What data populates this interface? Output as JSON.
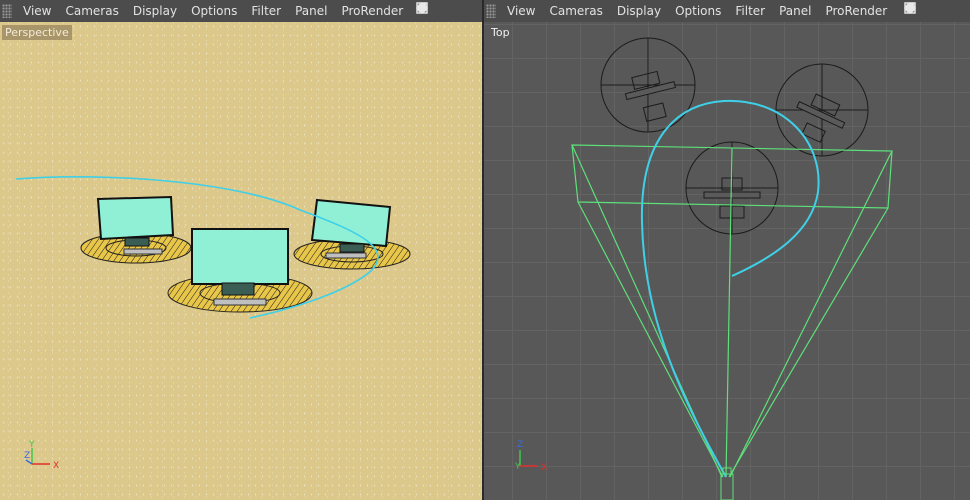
{
  "menu": {
    "items": [
      "View",
      "Cameras",
      "Display",
      "Options",
      "Filter",
      "Panel",
      "ProRender"
    ]
  },
  "viewports": {
    "left": {
      "label": "Perspective",
      "background": "#dcc88a"
    },
    "right": {
      "label": "Top",
      "background": "#585858"
    }
  },
  "axes": {
    "x": "X",
    "y": "Y",
    "z": "Z"
  },
  "colors": {
    "spline": "#3fd0e8",
    "camera_frustum": "#5ee07a",
    "screen": "#8ff0d6",
    "axis_x": "#e0302a",
    "axis_y": "#3ec84a",
    "axis_z": "#3a6be0"
  },
  "nav_icons": [
    "move-icon",
    "scale-icon",
    "rotate-icon",
    "maximize-icon"
  ]
}
